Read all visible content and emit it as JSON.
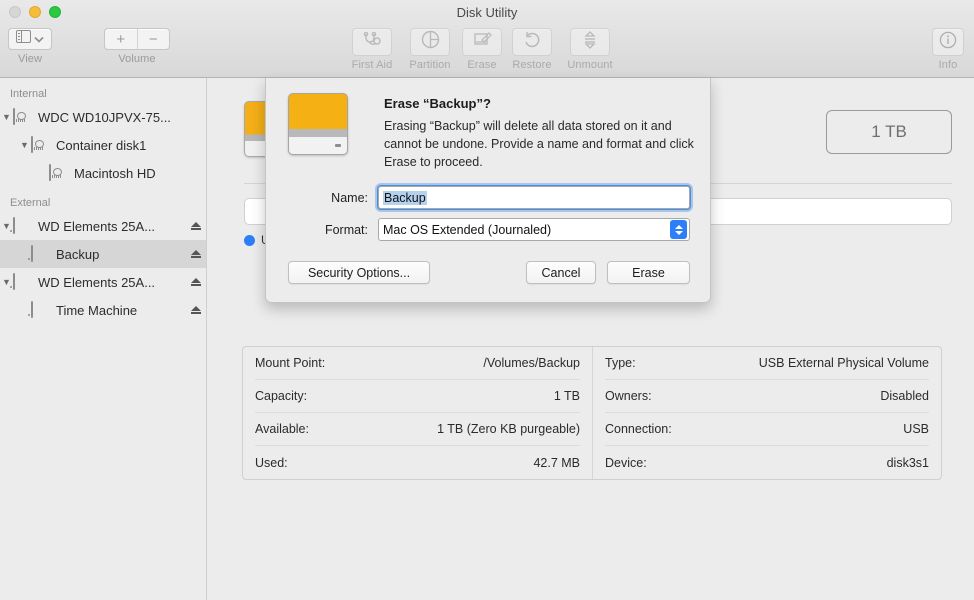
{
  "window": {
    "title": "Disk Utility",
    "traffic_lights": [
      "close",
      "minimize",
      "maximize"
    ]
  },
  "toolbar": {
    "view": {
      "label": "View",
      "icon": "sidebar-layout-icon",
      "chevron": "chevron-down-icon"
    },
    "volume": {
      "label": "Volume",
      "add": "+",
      "remove": "−"
    },
    "actions": [
      {
        "label": "First Aid",
        "icon": "stethoscope-icon",
        "enabled": false
      },
      {
        "label": "Partition",
        "icon": "pie-chart-icon",
        "enabled": false
      },
      {
        "label": "Erase",
        "icon": "erase-pencil-icon",
        "enabled": false
      },
      {
        "label": "Restore",
        "icon": "undo-arrow-icon",
        "enabled": false
      },
      {
        "label": "Unmount",
        "icon": "eject-stack-icon",
        "enabled": false
      }
    ],
    "info": {
      "label": "Info",
      "icon": "info-circle-icon"
    }
  },
  "sidebar": {
    "sections": [
      {
        "header": "Internal",
        "items": [
          {
            "label": "WDC WD10JPVX-75...",
            "icon": "internal-drive-icon",
            "indent": 0,
            "disclosure": "▼",
            "eject": false,
            "selected": false
          },
          {
            "label": "Container disk1",
            "icon": "internal-drive-icon",
            "indent": 1,
            "disclosure": "▼",
            "eject": false,
            "selected": false
          },
          {
            "label": "Macintosh HD",
            "icon": "internal-drive-icon",
            "indent": 2,
            "disclosure": "",
            "eject": false,
            "selected": false
          }
        ]
      },
      {
        "header": "External",
        "items": [
          {
            "label": "WD Elements 25A...",
            "icon": "external-drive-icon",
            "indent": 0,
            "disclosure": "▼",
            "eject": true,
            "selected": false
          },
          {
            "label": "Backup",
            "icon": "external-drive-icon",
            "indent": 1,
            "disclosure": "",
            "eject": true,
            "selected": true
          },
          {
            "label": "WD Elements 25A...",
            "icon": "external-drive-icon",
            "indent": 0,
            "disclosure": "▼",
            "eject": true,
            "selected": false
          },
          {
            "label": "Time Machine",
            "icon": "external-drive-icon",
            "indent": 1,
            "disclosure": "",
            "eject": true,
            "selected": false
          }
        ]
      }
    ]
  },
  "main": {
    "capacity_badge": "1 TB",
    "legend": [
      {
        "color": "#2d7ff9",
        "label": "Used"
      }
    ],
    "info_left": [
      {
        "key": "Mount Point:",
        "value": "/Volumes/Backup"
      },
      {
        "key": "Capacity:",
        "value": "1 TB"
      },
      {
        "key": "Available:",
        "value": "1 TB (Zero KB purgeable)"
      },
      {
        "key": "Used:",
        "value": "42.7 MB"
      }
    ],
    "info_right": [
      {
        "key": "Type:",
        "value": "USB External Physical Volume"
      },
      {
        "key": "Owners:",
        "value": "Disabled"
      },
      {
        "key": "Connection:",
        "value": "USB"
      },
      {
        "key": "Device:",
        "value": "disk3s1"
      }
    ]
  },
  "dialog": {
    "icon": "external-drive-icon",
    "heading": "Erase “Backup”?",
    "message": "Erasing “Backup” will delete all data stored on it and cannot be undone. Provide a name and format and click Erase to proceed.",
    "name_label": "Name:",
    "name_value": "Backup",
    "name_selected": true,
    "format_label": "Format:",
    "format_value": "Mac OS Extended (Journaled)",
    "security_label": "Security Options...",
    "cancel_label": "Cancel",
    "erase_label": "Erase"
  },
  "colors": {
    "accent": "#2d7ff9",
    "window_bg": "#ececec",
    "drive_orange": "#f3ae18",
    "selection": "#d6d6d6"
  }
}
